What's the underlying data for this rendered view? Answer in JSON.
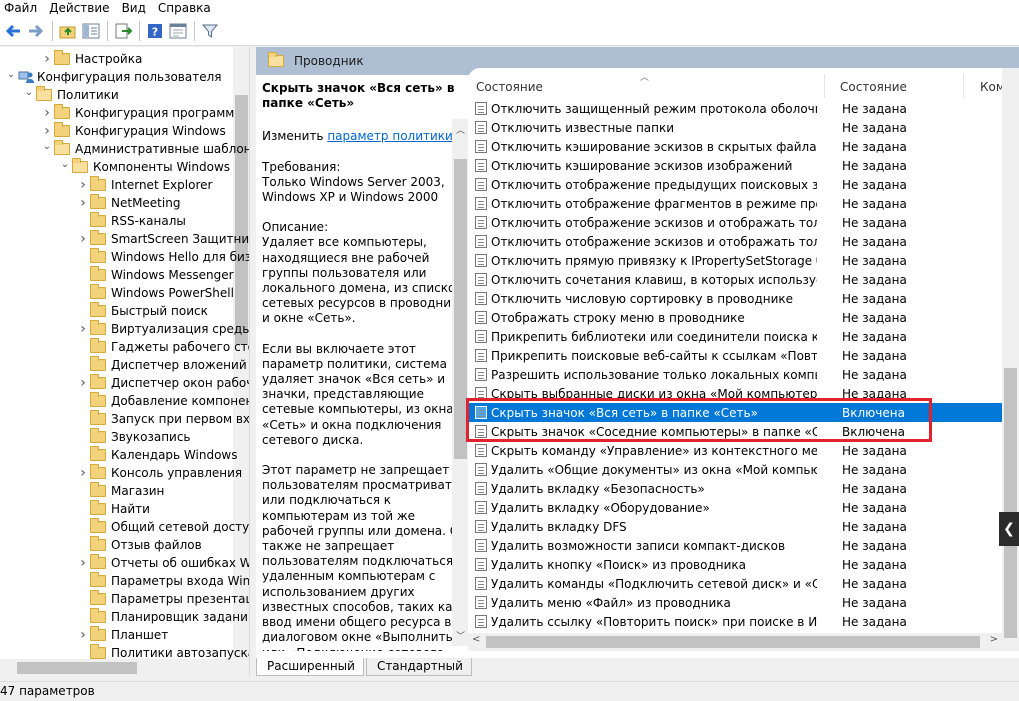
{
  "menu": [
    "Файл",
    "Действие",
    "Вид",
    "Справка"
  ],
  "toolbar_icons": [
    "back-icon",
    "forward-icon",
    "up-folder-icon",
    "show-hide-tree-icon",
    "export-list-icon",
    "help-icon",
    "properties-icon",
    "filter-icon"
  ],
  "tree": [
    {
      "label": "Настройка",
      "indent": 2,
      "arrow": "right"
    },
    {
      "label": "Конфигурация пользователя",
      "indent": 0,
      "arrow": "down",
      "icon": "computer"
    },
    {
      "label": "Политики",
      "indent": 1,
      "arrow": "down"
    },
    {
      "label": "Конфигурация программ",
      "indent": 2,
      "arrow": "right"
    },
    {
      "label": "Конфигурация Windows",
      "indent": 2,
      "arrow": "right"
    },
    {
      "label": "Административные шаблоны",
      "indent": 2,
      "arrow": "down"
    },
    {
      "label": "Компоненты Windows",
      "indent": 3,
      "arrow": "down"
    },
    {
      "label": "Internet Explorer",
      "indent": 4,
      "arrow": "right"
    },
    {
      "label": "NetMeeting",
      "indent": 4,
      "arrow": "right"
    },
    {
      "label": "RSS-каналы",
      "indent": 4,
      "arrow": ""
    },
    {
      "label": "SmartScreen Защитника",
      "indent": 4,
      "arrow": "right"
    },
    {
      "label": "Windows Hello для бизнеса",
      "indent": 4,
      "arrow": ""
    },
    {
      "label": "Windows Messenger",
      "indent": 4,
      "arrow": ""
    },
    {
      "label": "Windows PowerShell",
      "indent": 4,
      "arrow": ""
    },
    {
      "label": "Быстрый поиск",
      "indent": 4,
      "arrow": ""
    },
    {
      "label": "Виртуализация среды",
      "indent": 4,
      "arrow": "right"
    },
    {
      "label": "Гаджеты рабочего стола",
      "indent": 4,
      "arrow": ""
    },
    {
      "label": "Диспетчер вложений",
      "indent": 4,
      "arrow": ""
    },
    {
      "label": "Диспетчер окон рабочего",
      "indent": 4,
      "arrow": "right"
    },
    {
      "label": "Добавление компонентов",
      "indent": 4,
      "arrow": ""
    },
    {
      "label": "Запуск при первом входе",
      "indent": 4,
      "arrow": ""
    },
    {
      "label": "Звукозапись",
      "indent": 4,
      "arrow": ""
    },
    {
      "label": "Календарь Windows",
      "indent": 4,
      "arrow": ""
    },
    {
      "label": "Консоль управления",
      "indent": 4,
      "arrow": "right"
    },
    {
      "label": "Магазин",
      "indent": 4,
      "arrow": ""
    },
    {
      "label": "Найти",
      "indent": 4,
      "arrow": ""
    },
    {
      "label": "Общий сетевой доступ",
      "indent": 4,
      "arrow": ""
    },
    {
      "label": "Отзыв файлов",
      "indent": 4,
      "arrow": ""
    },
    {
      "label": "Отчеты об ошибках Windows",
      "indent": 4,
      "arrow": "right"
    },
    {
      "label": "Параметры входа Windows",
      "indent": 4,
      "arrow": ""
    },
    {
      "label": "Параметры презентации",
      "indent": 4,
      "arrow": ""
    },
    {
      "label": "Планировщик заданий",
      "indent": 4,
      "arrow": ""
    },
    {
      "label": "Планшет",
      "indent": 4,
      "arrow": "right"
    },
    {
      "label": "Политики автозапуска",
      "indent": 4,
      "arrow": ""
    }
  ],
  "panel": {
    "header": "Проводник",
    "desc_title": "Скрыть значок «Вся сеть» в папке «Сеть»",
    "edit_prefix": "Изменить ",
    "edit_link": "параметр политики",
    "requirements": "Требования:\nТолько Windows Server 2003, Windows XP и Windows 2000",
    "description": "Описание:\nУдаляет все компьютеры, находящиеся вне рабочей группы пользователя или локального домена, из списков сетевых ресурсов в проводнике и окне «Сеть».",
    "description2": "Если вы включаете этот параметр политики, система удаляет значок «Вся сеть» и значки, представляющие сетевые компьютеры, из окна «Сеть» и окна подключения сетевого диска.",
    "description3": "Этот параметр не запрещает пользователям просматривать или подключаться к компьютерам из той же рабочей группы или домена. Он также не запрещает пользователям подключаться к удаленным компьютерам с использованием других известных способов, таких как ввод имени общего ресурса в диалоговом окне «Выполнить» или «Подключение сетевого"
  },
  "columns": {
    "name": "Состояние",
    "status": "Состояние",
    "comment": "Комм"
  },
  "rows": [
    {
      "name": "Отключить защищенный режим протокола оболочки",
      "status": "Не задана"
    },
    {
      "name": "Отключить известные папки",
      "status": "Не задана"
    },
    {
      "name": "Отключить кэширование эскизов в скрытых файлах thumbs.db",
      "status": "Не задана"
    },
    {
      "name": "Отключить кэширование эскизов изображений",
      "status": "Не задана"
    },
    {
      "name": "Отключить отображение предыдущих поисковых запросов",
      "status": "Не задана"
    },
    {
      "name": "Отключить отображение фрагментов в режиме просмотра",
      "status": "Не задана"
    },
    {
      "name": "Отключить отображение эскизов и отображать только значки",
      "status": "Не задана"
    },
    {
      "name": "Отключить отображение эскизов и отображать только значки",
      "status": "Не задана"
    },
    {
      "name": "Отключить прямую привязку к IPropertySetStorage без промежуточного",
      "status": "Не задана"
    },
    {
      "name": "Отключить сочетания клавиш, в которых используется клавиша",
      "status": "Не задана"
    },
    {
      "name": "Отключить числовую сортировку в проводнике",
      "status": "Не задана"
    },
    {
      "name": "Отображать строку меню в проводнике",
      "status": "Не задана"
    },
    {
      "name": "Прикрепить библиотеки или соединители поиска к ссылкам",
      "status": "Не задана"
    },
    {
      "name": "Прикрепить поисковые веб-сайты к ссылкам «Повторить поиск»",
      "status": "Не задана"
    },
    {
      "name": "Разрешить использование только локальных компьютеров или",
      "status": "Не задана"
    },
    {
      "name": "Скрыть выбранные диски из окна «Мой компьютер»",
      "status": "Не задана"
    },
    {
      "name": "Скрыть значок «Вся сеть» в папке «Сеть»",
      "status": "Включена",
      "selected": true
    },
    {
      "name": "Скрыть значок «Соседние компьютеры» в папке «Сеть»",
      "status": "Включена"
    },
    {
      "name": "Скрыть команду «Управление» из контекстного меню проводника",
      "status": "Не задана"
    },
    {
      "name": "Удалить «Общие документы» из окна «Мой компьютер»",
      "status": "Не задана"
    },
    {
      "name": "Удалить вкладку «Безопасность»",
      "status": "Не задана"
    },
    {
      "name": "Удалить вкладку «Оборудование»",
      "status": "Не задана"
    },
    {
      "name": "Удалить вкладку DFS",
      "status": "Не задана"
    },
    {
      "name": "Удалить возможности записи компакт-дисков",
      "status": "Не задана"
    },
    {
      "name": "Удалить кнопку «Поиск» из проводника",
      "status": "Не задана"
    },
    {
      "name": "Удалить команды «Подключить сетевой диск» и «Отключить сетевой диск»",
      "status": "Не задана"
    },
    {
      "name": "Удалить меню «Файл» из проводника",
      "status": "Не задана"
    },
    {
      "name": "Удалить ссылку «Повторить поиск» при поиске в Интернете",
      "status": "Не задана"
    }
  ],
  "tabs": [
    "Расширенный",
    "Стандартный"
  ],
  "status_bar": "47 параметров",
  "colors": {
    "selected": "#0078d7",
    "highlight_box": "#e0232e",
    "header_bg": "#aebfd3"
  }
}
